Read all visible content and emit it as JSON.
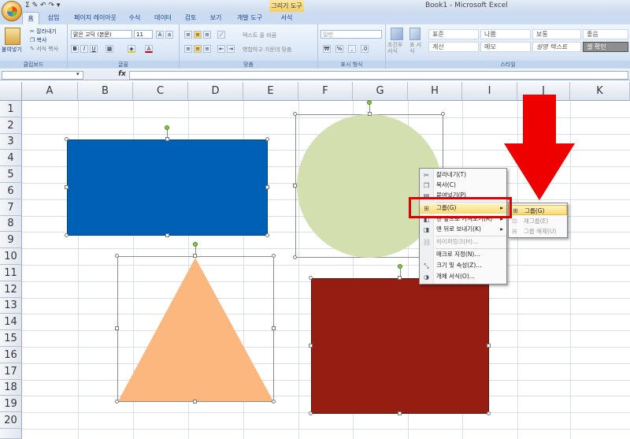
{
  "window": {
    "app_title": "Book1 - Microsoft Excel",
    "contextual_tab_title": "그리기 도구"
  },
  "ribbon_tabs": [
    "홈",
    "삽입",
    "페이지 레이아웃",
    "수식",
    "데이터",
    "검토",
    "보기",
    "개발 도구",
    "서식"
  ],
  "active_tab": "홈",
  "ribbon": {
    "clipboard": {
      "paste": "붙여넣기",
      "cut": "잘라내기",
      "copy": "복사",
      "format_painter": "서식 복사",
      "label": "클립보드"
    },
    "font": {
      "font_name": "맑은 고딕 (본문)",
      "font_size": "11",
      "label": "글꼴"
    },
    "alignment": {
      "wrap_text": "텍스트 줄 바꿈",
      "merge_center": "병합하고 가운데 맞춤",
      "label": "맞춤"
    },
    "number": {
      "format": "일반",
      "label": "표시 형식"
    },
    "styles": {
      "conditional_format": "조건부 서식",
      "table_format": "표 서식",
      "cells": [
        "표준",
        "나쁨",
        "보통",
        "좋음",
        "계산",
        "메모",
        "설명 텍스트",
        "셀 확인"
      ],
      "label": "스타일"
    }
  },
  "formula_bar": {
    "name_box": "",
    "fx": "fx",
    "formula": ""
  },
  "columns": [
    "A",
    "B",
    "C",
    "D",
    "E",
    "F",
    "G",
    "H",
    "I",
    "J",
    "K"
  ],
  "rows": [
    "1",
    "2",
    "3",
    "4",
    "5",
    "6",
    "7",
    "8",
    "9",
    "10",
    "11",
    "12",
    "13",
    "14",
    "15",
    "16",
    "17",
    "18",
    "19",
    "20"
  ],
  "shapes": {
    "rectangle_blue": "#0060b6",
    "circle_green": "#d4dfb0",
    "triangle_orange": "#fbb77d",
    "rectangle_red": "#951d12"
  },
  "context_menu": {
    "items": [
      {
        "label": "잘라내기(T)",
        "icon": "scissors-icon"
      },
      {
        "label": "복사(C)",
        "icon": "copy-icon"
      },
      {
        "label": "붙여넣기(P)",
        "icon": "paste-icon"
      },
      {
        "label": "그룹(G)",
        "icon": "group-icon",
        "submenu": true
      },
      {
        "label": "맨 앞으로 가져오기(R)",
        "icon": "bring-front-icon",
        "submenu": true
      },
      {
        "label": "맨 뒤로 보내기(K)",
        "icon": "send-back-icon",
        "submenu": true
      },
      {
        "label": "하이퍼링크(H)...",
        "icon": "hyperlink-icon",
        "disabled": true
      },
      {
        "label": "매크로 지정(N)...",
        "icon": ""
      },
      {
        "label": "크기 및 속성(Z)...",
        "icon": "size-icon"
      },
      {
        "label": "개체 서식(O)...",
        "icon": "format-object-icon"
      }
    ],
    "submenu": [
      {
        "label": "그룹(G)",
        "highlighted": true
      },
      {
        "label": "재그룹(E)",
        "disabled": true
      },
      {
        "label": "그룹 해제(U)",
        "disabled": true
      }
    ]
  },
  "annotation": {
    "highlight_color": "#e00000",
    "arrow_color": "#ee0000"
  }
}
